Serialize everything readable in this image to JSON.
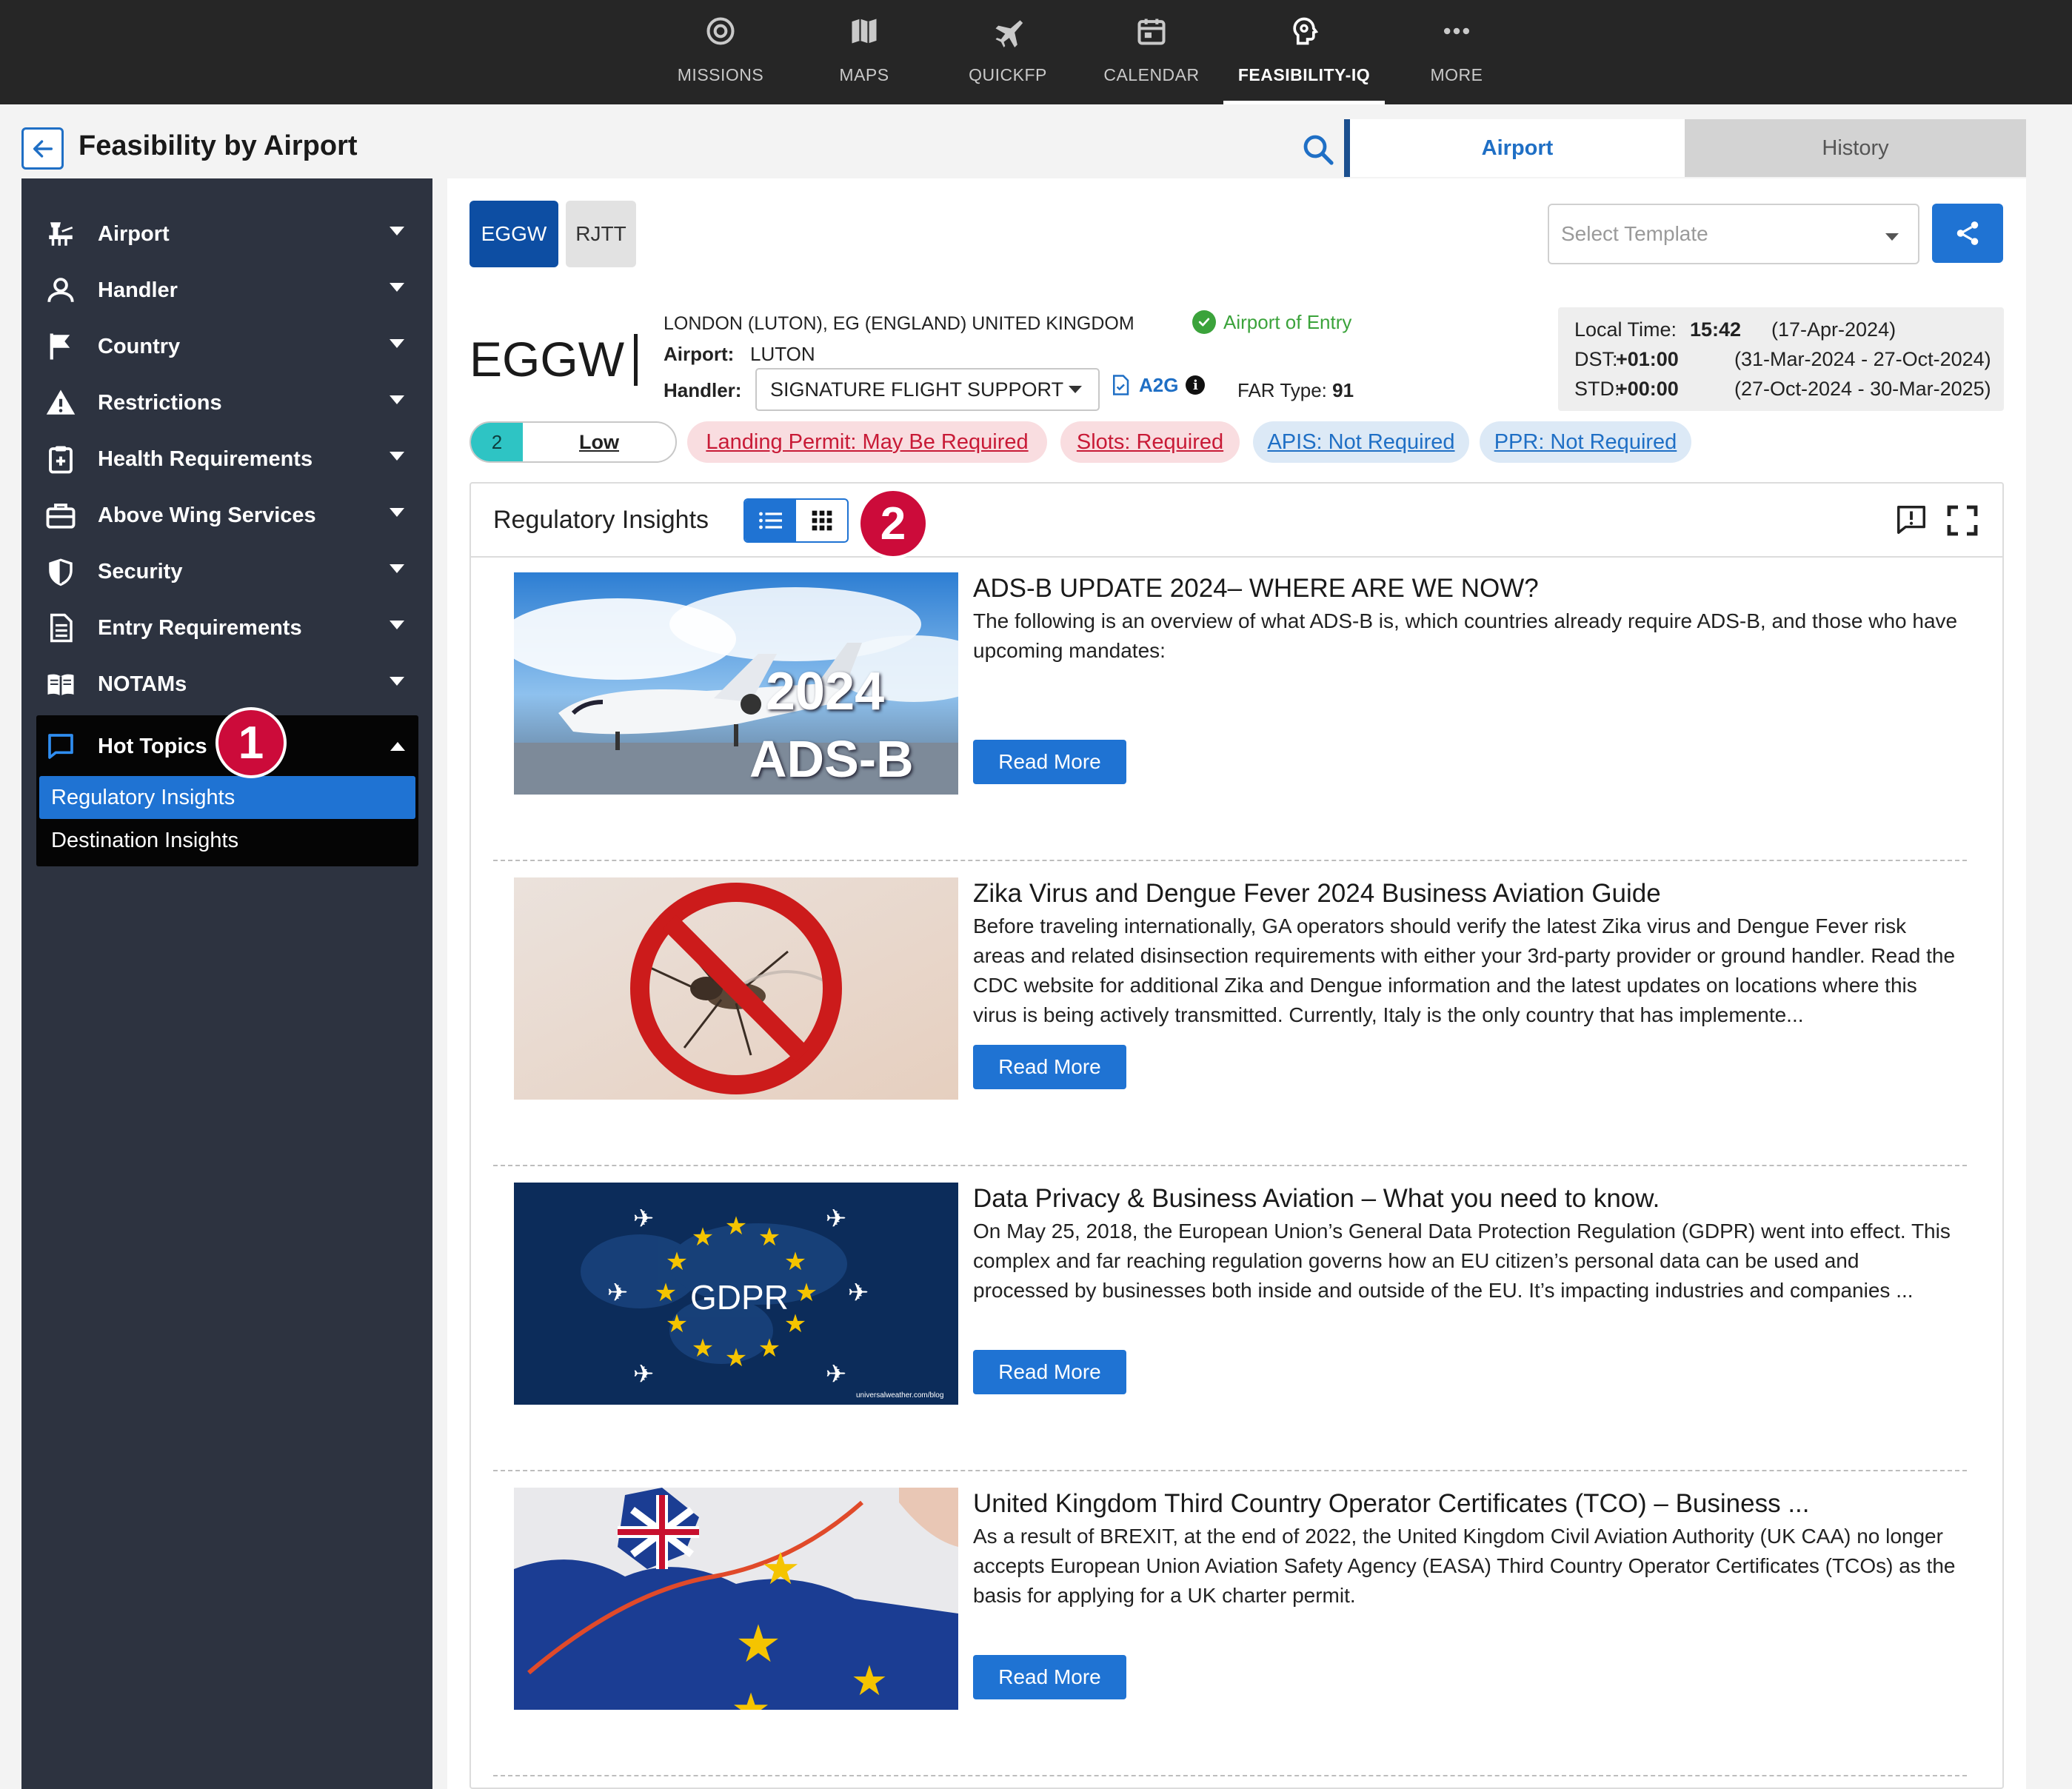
{
  "top_nav": {
    "items": [
      {
        "label": "MISSIONS",
        "icon": "target-icon"
      },
      {
        "label": "MAPS",
        "icon": "map-icon"
      },
      {
        "label": "QUICKFP",
        "icon": "plane-icon"
      },
      {
        "label": "CALENDAR",
        "icon": "calendar-icon"
      },
      {
        "label": "FEASIBILITY-IQ",
        "icon": "head-gear-icon",
        "active": true
      },
      {
        "label": "MORE",
        "icon": "more-dots-icon"
      }
    ]
  },
  "header": {
    "title": "Feasibility by Airport",
    "tabs": [
      {
        "label": "Airport",
        "active": true
      },
      {
        "label": "History",
        "active": false
      }
    ]
  },
  "sidebar": {
    "items": [
      {
        "label": "Airport",
        "icon": "airport-tower-icon"
      },
      {
        "label": "Handler",
        "icon": "person-icon"
      },
      {
        "label": "Country",
        "icon": "flag-icon"
      },
      {
        "label": "Restrictions",
        "icon": "warning-icon"
      },
      {
        "label": "Health Requirements",
        "icon": "clipboard-plus-icon"
      },
      {
        "label": "Above Wing Services",
        "icon": "briefcase-icon"
      },
      {
        "label": "Security",
        "icon": "shield-icon"
      },
      {
        "label": "Entry Requirements",
        "icon": "document-icon"
      },
      {
        "label": "NOTAMs",
        "icon": "open-book-icon"
      }
    ],
    "hot_topics": {
      "label": "Hot Topics",
      "icon": "chat-bubble-icon",
      "sub_items": [
        {
          "label": "Regulatory Insights",
          "active": true
        },
        {
          "label": "Destination Insights",
          "active": false
        }
      ]
    }
  },
  "annotations": {
    "badge1": "1",
    "badge2": "2"
  },
  "airport": {
    "codes": [
      "EGGW",
      "RJTT"
    ],
    "active_code": "EGGW",
    "template_placeholder": "Select Template",
    "icao": "EGGW",
    "location": "LONDON (LUTON), EG (ENGLAND) UNITED KINGDOM",
    "airport_label": "Airport:",
    "airport_name": "LUTON",
    "handler_label": "Handler:",
    "handler_value": "SIGNATURE FLIGHT SUPPORT",
    "a2g": "A2G",
    "info_glyph": "i",
    "far_label": "FAR Type:",
    "far_value": "91",
    "entry_status": "Airport of Entry",
    "times": {
      "local_label": "Local Time:",
      "local_value": "15:42",
      "local_date": "(17-Apr-2024)",
      "dst_label": "DST:",
      "dst_value": "+01:00",
      "dst_range": "(31-Mar-2024 - 27-Oct-2024)",
      "std_label": "STD:",
      "std_value": "+00:00",
      "std_range": "(27-Oct-2024 - 30-Mar-2025)"
    },
    "risk": {
      "score": "2",
      "level": "Low"
    },
    "requirements": [
      {
        "label": "Landing Permit: May Be Required",
        "status": "red"
      },
      {
        "label": "Slots: Required",
        "status": "red"
      },
      {
        "label": "APIS: Not Required",
        "status": "blue"
      },
      {
        "label": "PPR: Not Required",
        "status": "blue"
      }
    ]
  },
  "insights": {
    "title": "Regulatory Insights",
    "view_mode": "list",
    "read_more_label": "Read More",
    "articles": [
      {
        "title": "ADS-B UPDATE 2024– WHERE ARE WE NOW?",
        "body": "The following is an overview of what ADS-B is, which countries already require ADS-B, and those who have upcoming mandates:",
        "image_text": [
          "2024",
          "ADS-B"
        ]
      },
      {
        "title": "Zika Virus and Dengue Fever 2024 Business Aviation Guide",
        "body": "Before traveling internationally, GA operators should verify the latest Zika virus and Dengue Fever risk areas and related disinsection requirements with either your 3rd-party provider or ground handler. Read the CDC website for additional Zika and Dengue information and the latest updates on locations where this virus is being actively transmitted. Currently, Italy is the only country that has implemente..."
      },
      {
        "title": "Data Privacy & Business Aviation – What you need to know.",
        "body": "On May 25, 2018, the European Union’s General Data Protection Regulation (GDPR) went into effect. This complex and far reaching regulation governs how an EU citizen’s personal data can be used and processed by businesses both inside and outside of the EU. It’s impacting industries and companies ...",
        "image_text": [
          "GDPR",
          "universalweather.com/blog"
        ]
      },
      {
        "title": "United Kingdom Third Country Operator Certificates (TCO) – Business ...",
        "body": "As a result of BREXIT, at the end of 2022, the United Kingdom Civil Aviation Authority (UK CAA) no longer accepts European Union Aviation Safety Agency (EASA) Third Country Operator Certificates (TCOs) as the basis for applying for a UK charter permit."
      }
    ]
  },
  "colors": {
    "topnav_bg": "#262626",
    "sidebar_bg": "#2d3340",
    "accent_blue": "#1f73d3",
    "badge_red": "#cc0b3a",
    "risk_teal": "#2ec4c4",
    "chip_red_text": "#c81a36",
    "entry_green": "#3ba33b"
  }
}
